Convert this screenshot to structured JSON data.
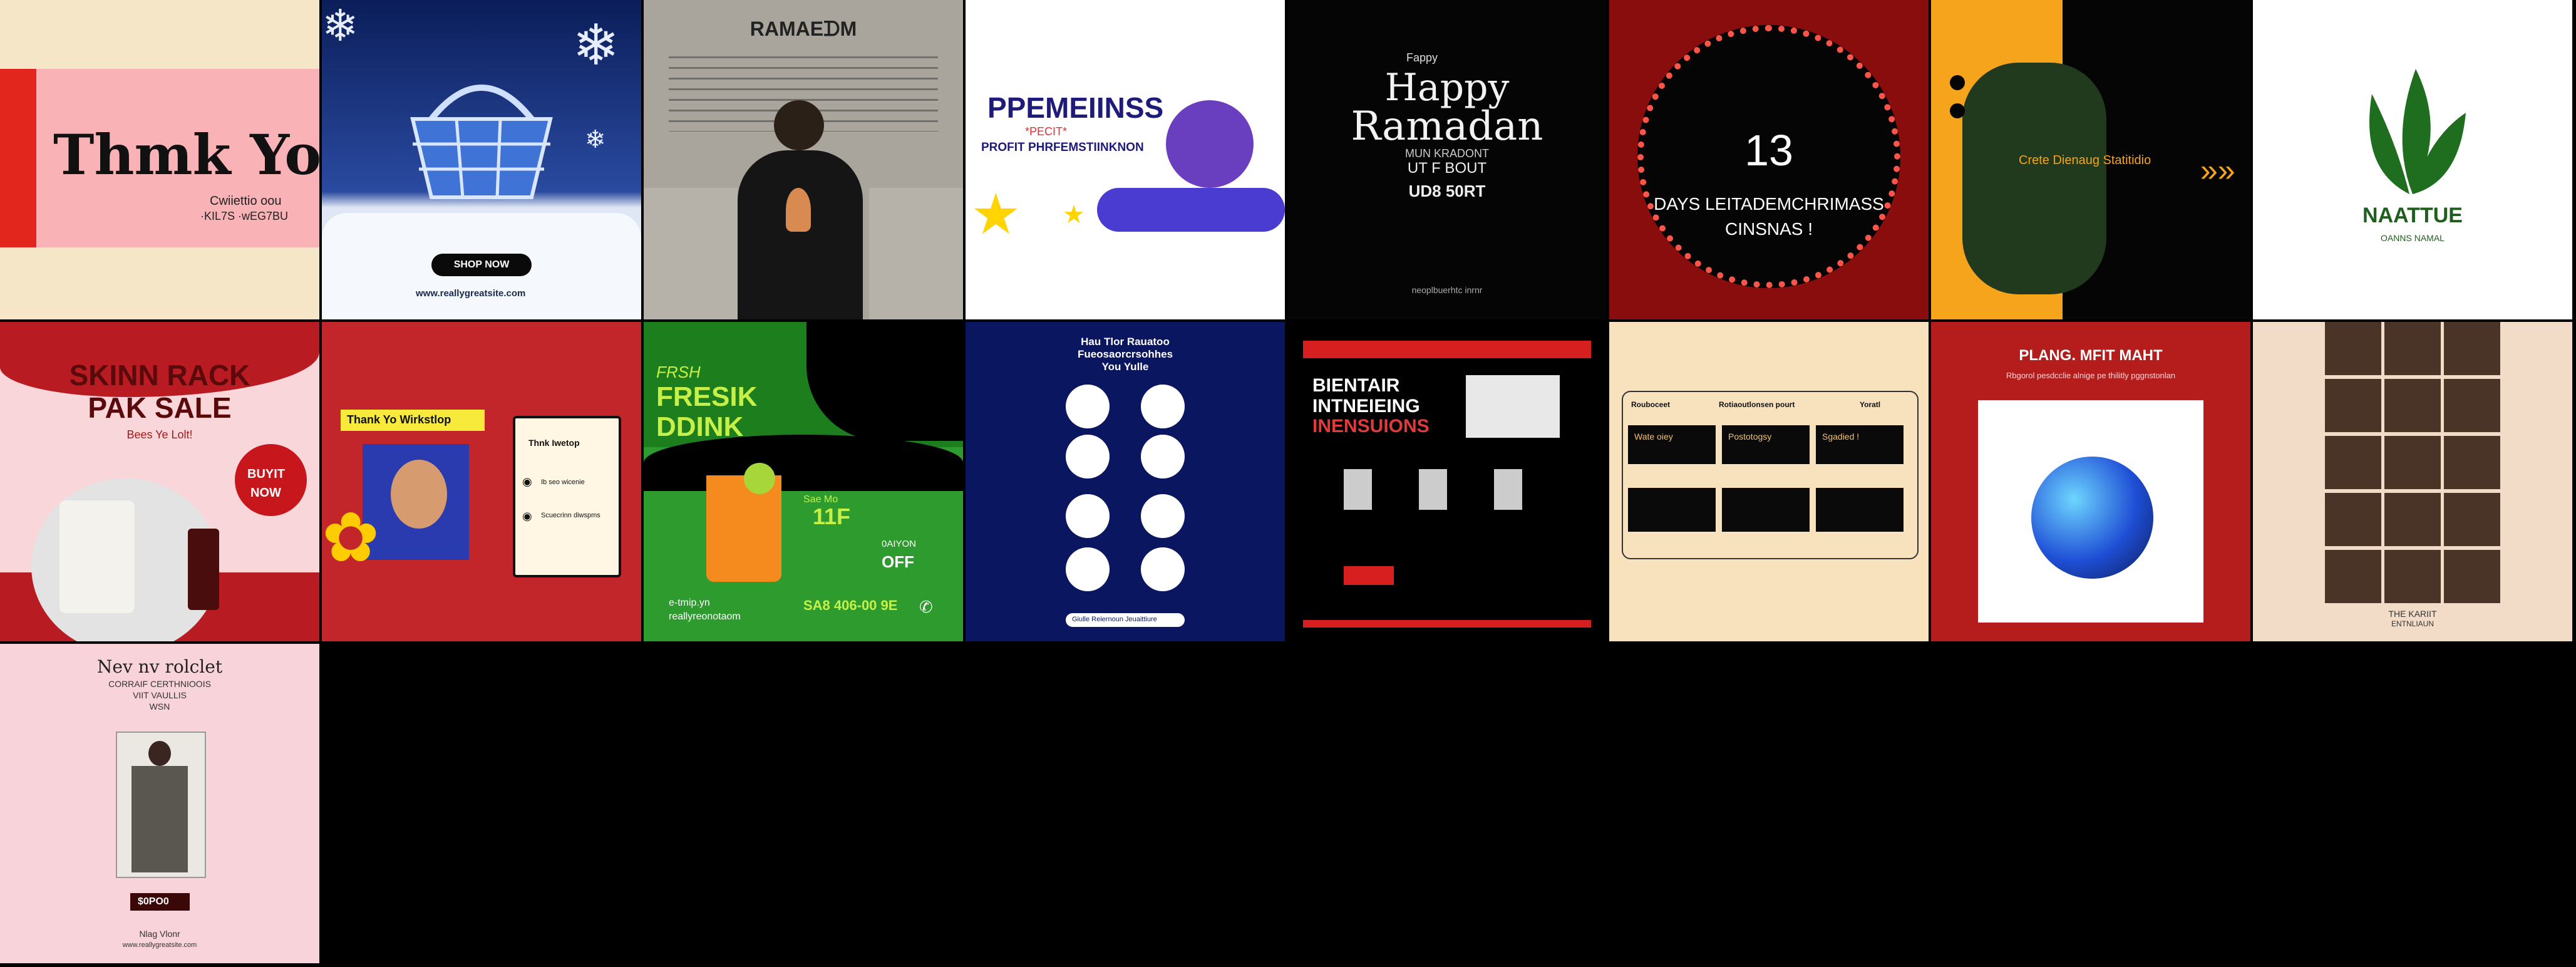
{
  "tiles": [
    {
      "id": "thank-you",
      "title": "Thmk You",
      "sub1": "Cwiiettio oou",
      "sub2": "·KIL7S ·wEG7BU"
    },
    {
      "id": "winter-basket",
      "button": "SHOP NOW",
      "url": "www.reallygreatsite.com"
    },
    {
      "id": "ramadan-man",
      "title": "RAMAEᗪM"
    },
    {
      "id": "premiums",
      "title": "PPEMEIINSS",
      "sub1": "*PECIT*",
      "sub2": "PROFIT PHRFEMSTIINKNON"
    },
    {
      "id": "happy-ramadan",
      "small1": "Fappy",
      "h1": "Happy",
      "h2": "Ramadan",
      "h3": "MUN KRADONT",
      "l1": "UT F BOUT",
      "l2": "UD8 50RT",
      "foot": "neoplbuerhtc inrnr"
    },
    {
      "id": "days-christmas",
      "num": "13",
      "l1": "DAYS LEITADEMCHRIMASS",
      "l2": "CINSNAS !"
    },
    {
      "id": "create-studio",
      "text": "Crete Dienaug Statitidio",
      "arrows": "»»"
    },
    {
      "id": "naattue",
      "title": "NAATTUE",
      "sub": "OANNS NAMAL"
    },
    {
      "id": "skin-pack",
      "l1": "SKINN RACK",
      "l2": "PAK SALE",
      "l3": "Bees Ye Lolt!",
      "badge1": "BUYIT",
      "badge2": "NOW"
    },
    {
      "id": "thank-workshop",
      "banner": "Thank Yo Wirkstlop",
      "card": "Thnk Iwetop",
      "item1": "Ib seo wicenie",
      "item2": "Scuecrinn diwspms"
    },
    {
      "id": "fresh-drink",
      "l0": "FRSH",
      "l1": "FRESIK",
      "l2": "DDINK",
      "price1": "Sae Mo",
      "price2": "11F",
      "off1": "0AIYON",
      "off2": "OFF",
      "url1": "e-tmip.yn",
      "url2": "reallyreonotaom",
      "phone": "SA8 406-00 9E"
    },
    {
      "id": "how-the-results",
      "l1": "Hau Tlor Rauatoo",
      "l2": "Fueosaorcrsohhes",
      "l3": "You Yulle",
      "footer": "Giulle Reiernoun Jeuaittiure"
    },
    {
      "id": "training-webinar",
      "h1": "BIENTAIR",
      "h2": "INTNEIEING",
      "h3": "INENSUIONS"
    },
    {
      "id": "table-card",
      "c1": "Rouboceet",
      "c2": "Rotiaoutlonsen pourt",
      "c3": "Yoratl",
      "r1": "Wate oiey",
      "r2": "Postotogsy",
      "r3": "Sgadied !"
    },
    {
      "id": "planet",
      "title": "PLANG. MFIT   MAHT",
      "sub": "Rbgorol pesdcclie alnige pe thilitly pggnstonlan"
    },
    {
      "id": "collage",
      "l1": "THE KARIIT",
      "l2": "ENTNLIAUN"
    },
    {
      "id": "new-product",
      "l1": "Nev nv rolclet",
      "l2": "CORRAIF CERTHNIOOIS",
      "l3": "VIIT VAULLIS",
      "l4": "WSN",
      "price": "$0PO0",
      "foot1": "Nlag Vlonr",
      "foot2": "www.reallygreatsite.com"
    }
  ],
  "icons": [
    "snowflake-icon",
    "basket-icon",
    "star-icon",
    "unicorn-icon",
    "cloud-icon",
    "leaf-logo-icon",
    "check-icon",
    "flower-icon",
    "phone-icon",
    "planet-icon"
  ]
}
